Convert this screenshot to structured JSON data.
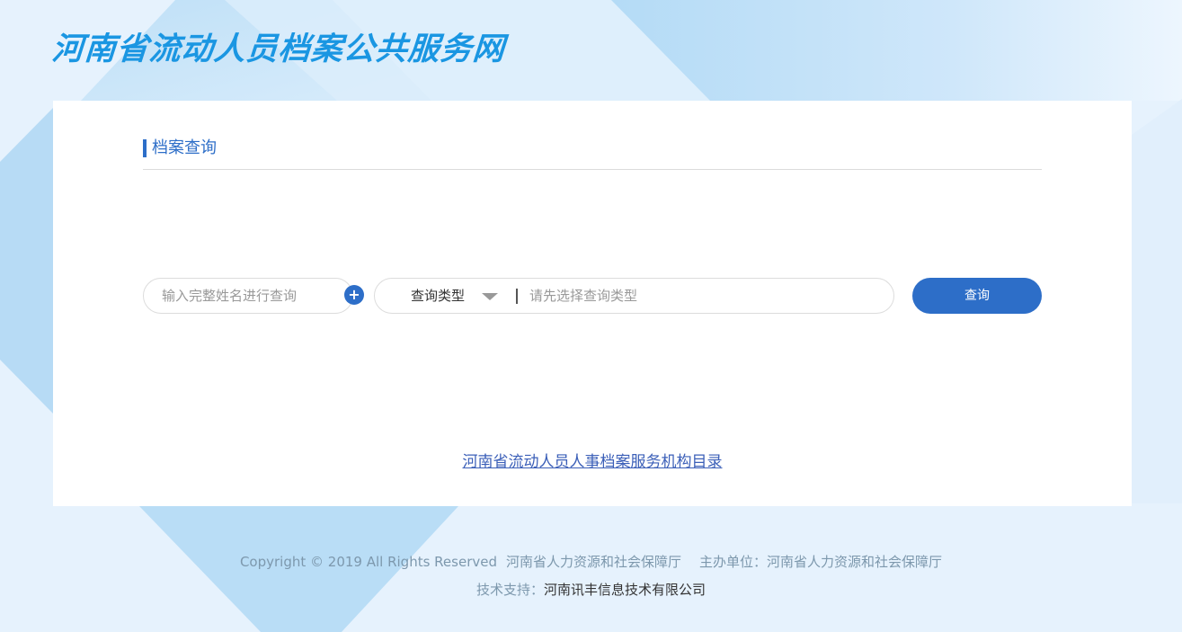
{
  "header": {
    "site_title": "河南省流动人员档案公共服务网"
  },
  "query_panel": {
    "section_title": "档案查询",
    "name_input": {
      "placeholder": "输入完整姓名进行查询",
      "value": ""
    },
    "add_button": "+",
    "type_select": {
      "selected": "查询类型"
    },
    "type_value_input": {
      "placeholder": "请先选择查询类型",
      "value": ""
    },
    "search_button": "查询",
    "directory_link": "河南省流动人员人事档案服务机构目录"
  },
  "footer": {
    "copyright": "Copyright © 2019 All Rights Reserved",
    "owner": "河南省人力资源和社会保障厅",
    "sponsor_label": "主办单位：",
    "sponsor": "河南省人力资源和社会保障厅",
    "support_label": "技术支持：",
    "support": "河南讯丰信息技术有限公司"
  },
  "colors": {
    "brand_blue": "#1a96e2",
    "accent": "#2d6ec8",
    "link": "#3b5fb8",
    "footer_text": "#7d98ad",
    "background": "#e6f2fd"
  }
}
